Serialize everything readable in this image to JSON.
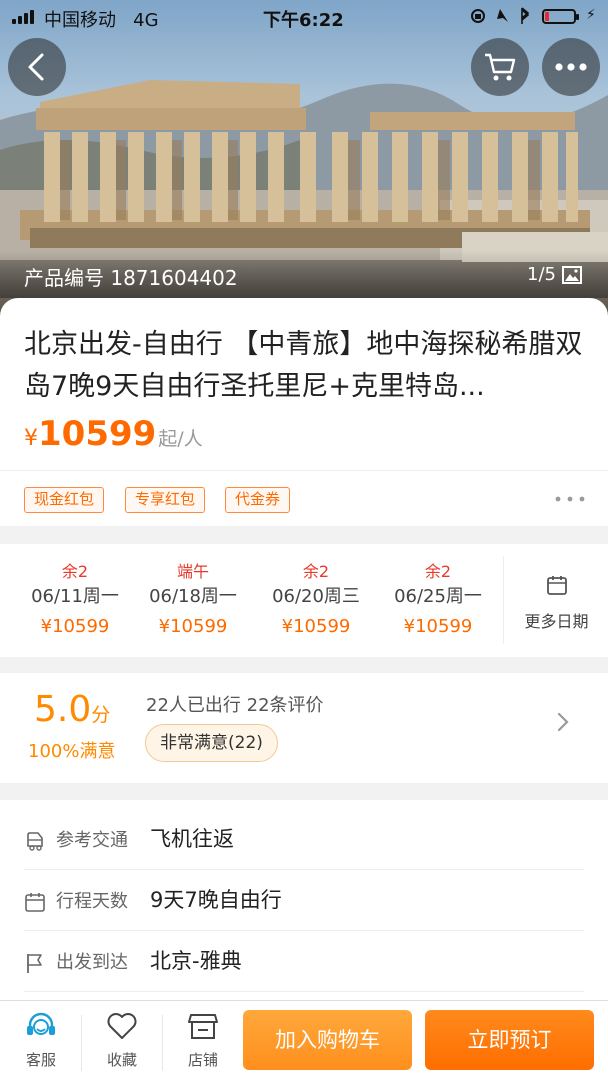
{
  "status_bar": {
    "carrier": "中国移动",
    "network": "4G",
    "time": "下午6:22",
    "battery_percent": 15
  },
  "hero": {
    "product_code": "产品编号 1871604402",
    "image_counter": "1/5"
  },
  "title": "北京出发-自由行 【中青旅】地中海探秘希腊双岛7晚9天自由行圣托里尼+克里特岛...",
  "price": {
    "currency": "¥",
    "amount": "10599",
    "unit": "起/人",
    "color": "#ff6a00"
  },
  "coupons": [
    "现金红包",
    "专享红包",
    "代金券"
  ],
  "dates": [
    {
      "tag": "余2",
      "day": "06/11周一",
      "price": "¥10599"
    },
    {
      "tag": "端午",
      "day": "06/18周一",
      "price": "¥10599"
    },
    {
      "tag": "余2",
      "day": "06/20周三",
      "price": "¥10599"
    },
    {
      "tag": "余2",
      "day": "06/25周一",
      "price": "¥10599"
    }
  ],
  "more_dates": "更多日期",
  "rating": {
    "score": "5.0",
    "score_unit": "分",
    "satisfaction": "100%满意",
    "stats": "22人已出行 22条评价",
    "badge": "非常满意(22)"
  },
  "info": [
    {
      "icon": "transport-icon",
      "key": "参考交通",
      "value": "飞机往返"
    },
    {
      "icon": "calendar-icon",
      "key": "行程天数",
      "value": "9天7晚自由行"
    },
    {
      "icon": "flag-icon",
      "key": "出发到达",
      "value": "北京-雅典"
    }
  ],
  "bottom_bar": {
    "tabs": [
      "客服",
      "收藏",
      "店铺"
    ],
    "add_to_cart": "加入购物车",
    "book_now": "立即预订"
  }
}
